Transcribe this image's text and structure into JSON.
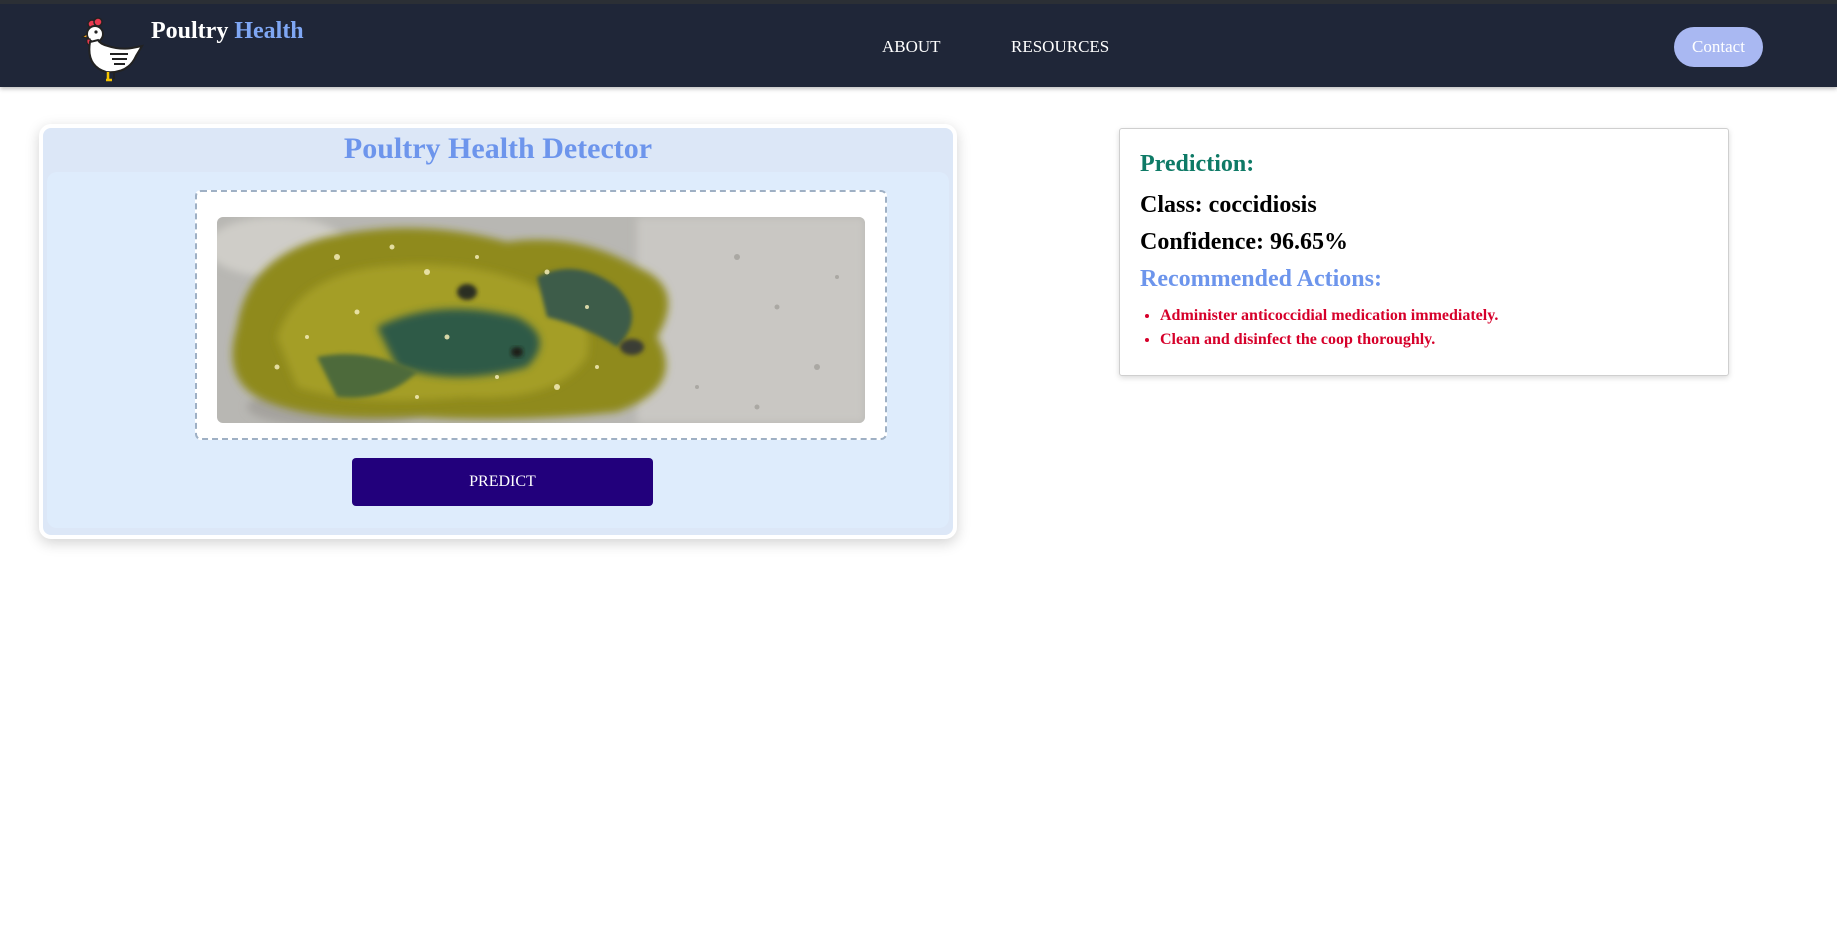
{
  "navbar": {
    "logo_icon": "chicken-logo-icon",
    "brand_primary": "Poultry",
    "brand_accent": "Health",
    "links": [
      {
        "label": "ABOUT"
      },
      {
        "label": "RESOURCES"
      }
    ],
    "contact_label": "Contact"
  },
  "detector": {
    "title": "Poultry Health Detector",
    "preview_image": "uploaded-droppings-image",
    "predict_label": "PREDICT"
  },
  "result": {
    "prediction_heading": "Prediction:",
    "class_line": "Class: coccidiosis",
    "confidence_line": "Confidence: 96.65%",
    "recommended_heading": "Recommended Actions:",
    "actions": [
      "Administer anticoccidial medication immediately.",
      "Clean and disinfect the coop thoroughly."
    ]
  },
  "colors": {
    "navbar_bg": "#1f2638",
    "brand_accent": "#7fa7f4",
    "contact_bg": "#a9b8f2",
    "title_blue": "#6d95ec",
    "predict_bg": "#22007c",
    "prediction_green": "#0e7a66",
    "action_red": "#d6002a"
  }
}
